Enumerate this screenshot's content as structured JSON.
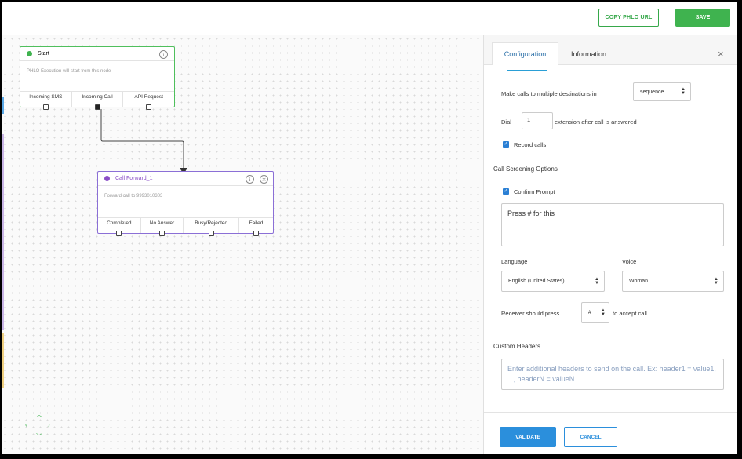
{
  "topbar": {
    "copy_url_label": "COPY PHLO URL",
    "save_label": "SAVE"
  },
  "nodes": {
    "start": {
      "title": "Start",
      "description": "PHLO Execution will start from this node",
      "ports": [
        "Incoming SMS",
        "Incoming Call",
        "API Request"
      ],
      "dot_color": "#3fb34f"
    },
    "call_forward": {
      "title": "Call Forward_1",
      "description": "Forward call to 9993010303",
      "ports": [
        "Completed",
        "No Answer",
        "Busy/Rejected",
        "Failed"
      ],
      "dot_color": "#8b4fc7"
    }
  },
  "nav": {
    "icons": [
      "arrow-up-icon",
      "arrow-left-icon",
      "arrow-right-icon",
      "arrow-down-icon"
    ]
  },
  "panel": {
    "tabs": [
      "Configuration",
      "Information"
    ],
    "close_icon": "×",
    "multi_dest_label": "Make calls to multiple destinations in",
    "multi_dest_value": "sequence",
    "dial_label": "Dial",
    "dial_value": "1",
    "dial_suffix": "extension after call is answered",
    "record_calls_label": "Record calls",
    "record_calls_checked": true,
    "screening_title": "Call Screening Options",
    "confirm_prompt_label": "Confirm Prompt",
    "confirm_prompt_checked": true,
    "prompt_text": "Press # for this",
    "language_label": "Language",
    "language_value": "English (United States)",
    "voice_label": "Voice",
    "voice_value": "Woman",
    "receiver_label": "Receiver should press",
    "receiver_value": "#",
    "receiver_suffix": "to accept call",
    "custom_headers_title": "Custom Headers",
    "custom_headers_placeholder": "Enter additional headers to send on the call. Ex: header1 = value1, ..., headerN = valueN",
    "validate_label": "VALIDATE",
    "cancel_label": "CANCEL"
  },
  "colors": {
    "accent_green": "#3fb34f",
    "accent_blue": "#2b8fdc",
    "call_forward_purple": "#8b4fc7"
  }
}
